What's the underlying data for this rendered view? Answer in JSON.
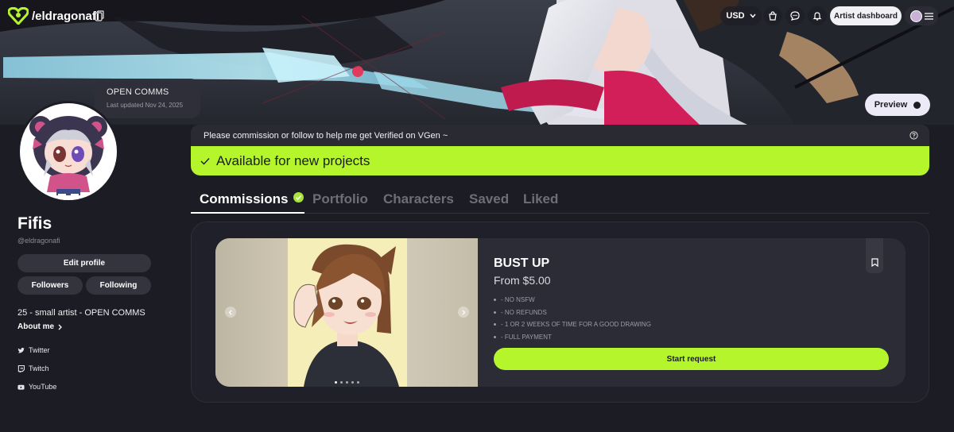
{
  "colors": {
    "accent": "#b4f52c",
    "background": "#1c1c24",
    "panel": "#20202a",
    "card": "#2c2c36"
  },
  "topnav": {
    "logo_icon": "vgen-logo-icon",
    "handle": "/eldragonafi",
    "currency": "USD",
    "icons": [
      "copy-icon",
      "shopping-bag-icon",
      "chat-icon",
      "bell-icon",
      "hamburger-menu-icon"
    ],
    "artist_dashboard_label": "Artist dashboard"
  },
  "banner": {
    "preview_label": "Preview"
  },
  "status": {
    "title": "OPEN COMMS",
    "updated": "Last updated Nov 24, 2025"
  },
  "profile": {
    "name": "Fifis",
    "handle": "@eldragonafi",
    "edit_profile_label": "Edit profile",
    "followers_label": "Followers",
    "following_label": "Following",
    "bio": "25 - small artist - OPEN COMMS",
    "about_label": "About me",
    "socials": [
      {
        "label": "Twitter",
        "icon": "twitter-icon"
      },
      {
        "label": "Twitch",
        "icon": "twitch-icon"
      },
      {
        "label": "YouTube",
        "icon": "youtube-icon"
      }
    ]
  },
  "announcement": {
    "text": "Please commission or follow to help me get Verified on VGen ~",
    "available_text": "Available for new projects"
  },
  "tabs": [
    {
      "label": "Commissions",
      "active": true
    },
    {
      "label": "Portfolio",
      "active": false
    },
    {
      "label": "Characters",
      "active": false
    },
    {
      "label": "Saved",
      "active": false
    },
    {
      "label": "Liked",
      "active": false
    }
  ],
  "commission": {
    "title": "BUST UP",
    "price": "From $5.00",
    "items": [
      "- NO NSFW",
      "- NO REFUNDS",
      "- 1 OR 2 WEEKS OF TIME FOR A GOOD DRAWING",
      "- FULL PAYMENT"
    ],
    "start_label": "Start request",
    "image_count": 5,
    "image_index": 1
  }
}
